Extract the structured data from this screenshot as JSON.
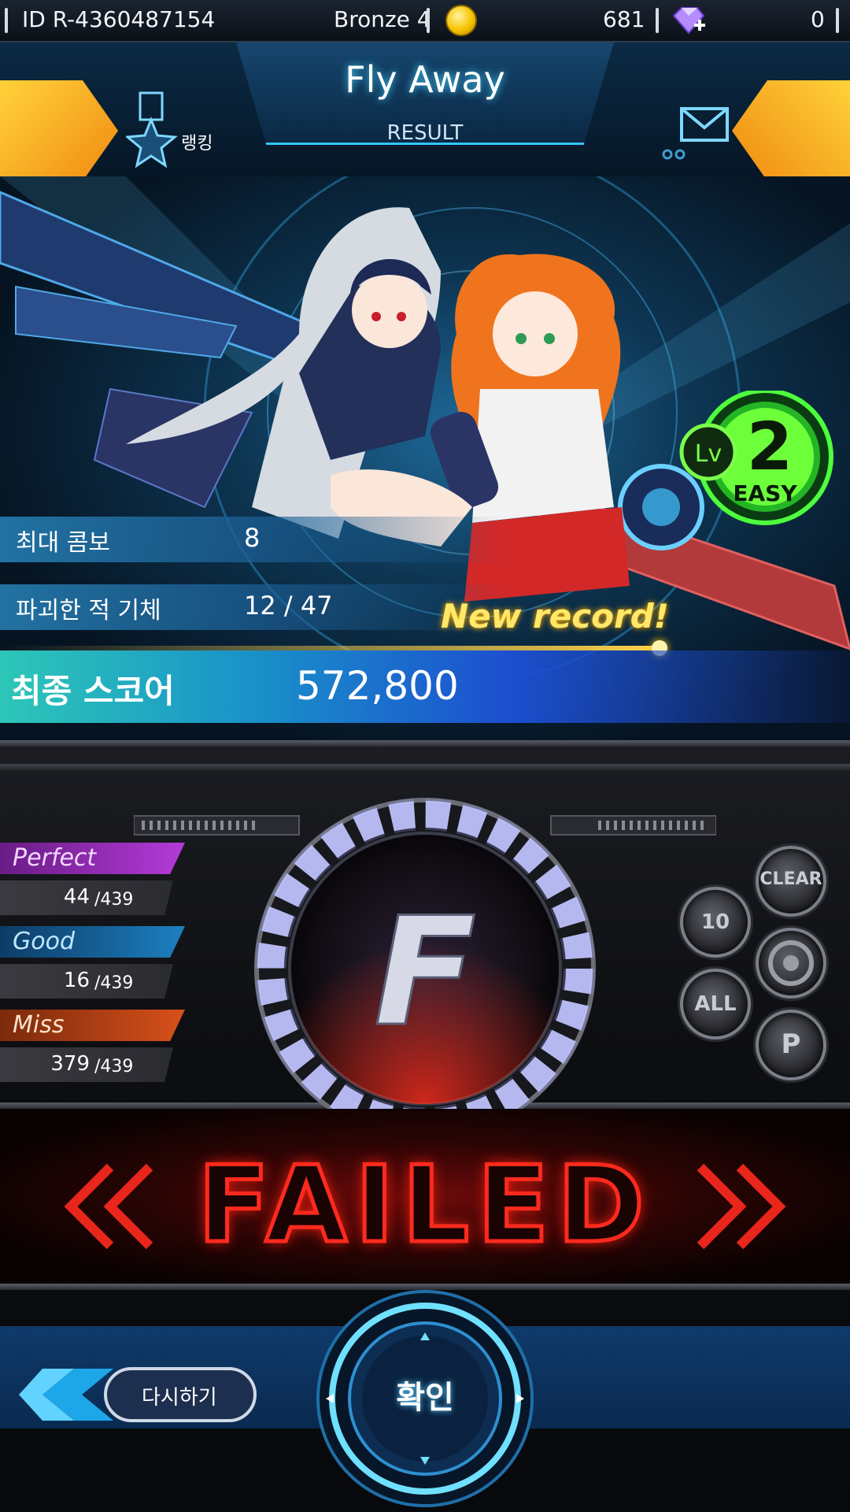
{
  "status_bar": {
    "player_id": "ID  R-4360487154",
    "tier": "Bronze 4",
    "coins": "681",
    "gems": "0"
  },
  "header": {
    "song_title": "Fly Away",
    "subtitle": "RESULT",
    "ranking_label": "랭킹"
  },
  "level_badge": {
    "prefix": "Lv",
    "level": "2",
    "difficulty": "EASY"
  },
  "stats": {
    "max_combo_label": "최대 콤보",
    "max_combo_value": "8",
    "destroyed_label": "파괴한 적 기체",
    "destroyed_value": "12 / 47",
    "new_record": "New record!",
    "final_score_label": "최종 스코어",
    "final_score_value": "572,800"
  },
  "judgements": {
    "perfect_label": "Perfect",
    "perfect_count": "44",
    "good_label": "Good",
    "good_count": "16",
    "miss_label": "Miss",
    "miss_count": "379",
    "total": "439"
  },
  "grade": "F",
  "side_buttons": {
    "clear": "CLEAR",
    "ten": "10",
    "all": "ALL",
    "p": "P"
  },
  "result_banner": "FAILED",
  "buttons": {
    "retry": "다시하기",
    "confirm": "확인"
  },
  "colors": {
    "perfect": "#b43ad8",
    "good": "#1d7fc0",
    "miss": "#d8501a",
    "accent": "#35c6ff",
    "failed": "#ff2a1e"
  }
}
